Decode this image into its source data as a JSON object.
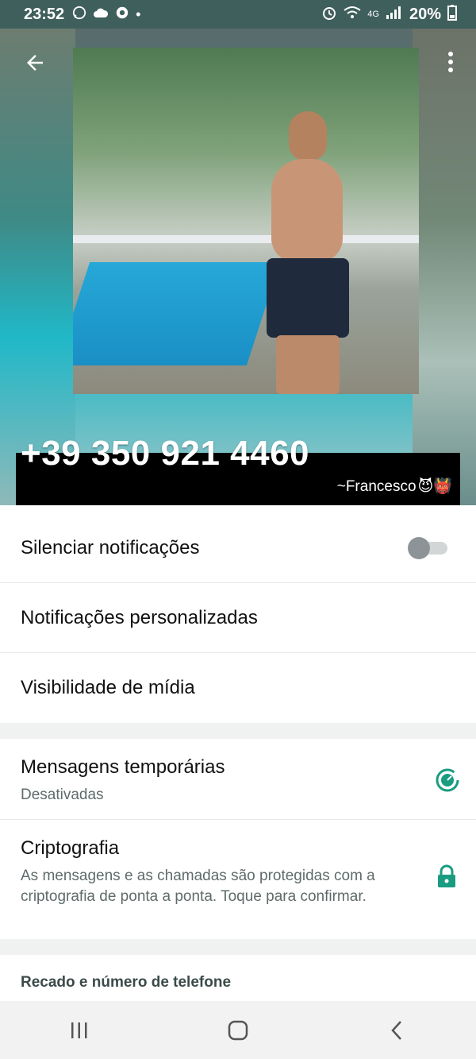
{
  "status_bar": {
    "time": "23:52",
    "battery": "20%",
    "icons": [
      "whatsapp-icon",
      "cloud-icon",
      "chrome-icon",
      "dot-icon",
      "alarm-icon",
      "wifi-icon",
      "4g-icon",
      "signal-icon",
      "battery-icon"
    ]
  },
  "header": {
    "phone_number": "+39 350 921 4460",
    "push_name": "~Francesco",
    "push_name_emojis": "😈👹"
  },
  "settings": {
    "mute_label": "Silenciar notificações",
    "mute_on": false,
    "custom_notifications_label": "Notificações personalizadas",
    "media_visibility_label": "Visibilidade de mídia"
  },
  "privacy": {
    "disappearing_label": "Mensagens temporárias",
    "disappearing_value": "Desativadas",
    "encryption_label": "Criptografia",
    "encryption_desc": "As mensagens e as chamadas são protegidas com a criptografia de ponta a ponta. Toque para confirmar."
  },
  "about": {
    "section_label": "Recado e número de telefone"
  },
  "colors": {
    "accent": "#1a9c81",
    "status_bar": "#3f5f5c"
  }
}
